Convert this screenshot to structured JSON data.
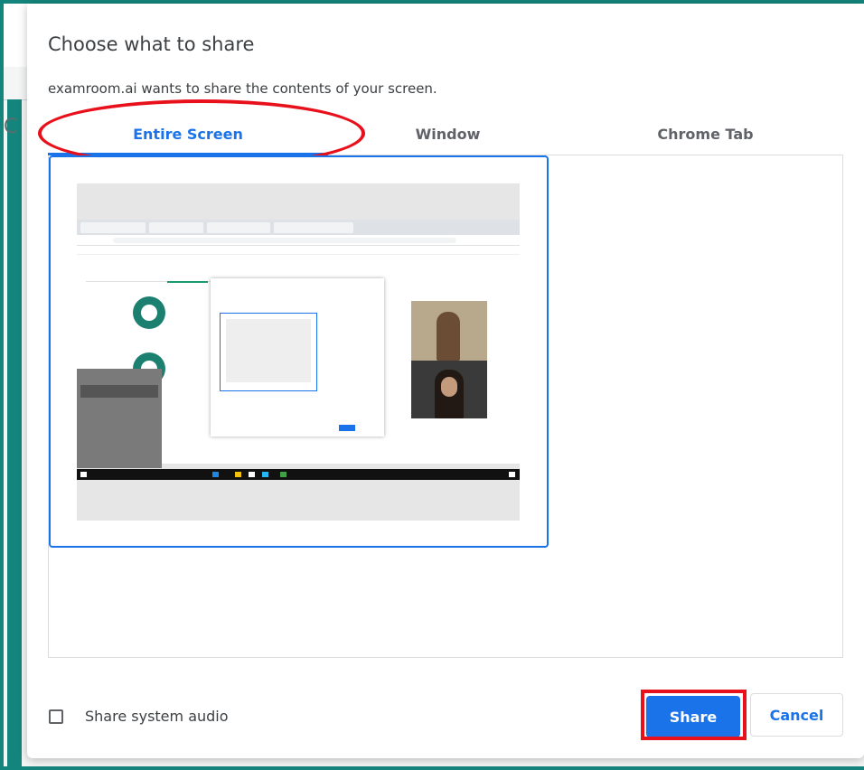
{
  "background": {
    "letter": "C"
  },
  "dialog": {
    "title": "Choose what to share",
    "subtitle": "examroom.ai wants to share the contents of your screen."
  },
  "tabs": [
    {
      "label": "Entire Screen",
      "selected": true
    },
    {
      "label": "Window",
      "selected": false
    },
    {
      "label": "Chrome Tab",
      "selected": false
    }
  ],
  "footer": {
    "checkbox_label": "Share system audio",
    "checkbox_checked": false,
    "share_label": "Share",
    "cancel_label": "Cancel"
  },
  "colors": {
    "accent": "#1a73e8",
    "annotation": "#e8101a",
    "frame": "#14857c"
  }
}
